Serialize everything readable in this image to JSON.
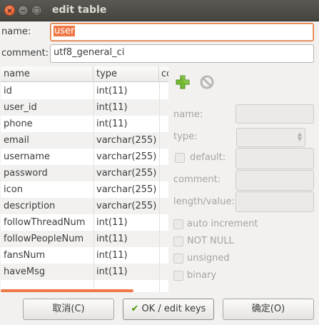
{
  "window": {
    "title": "edit table",
    "close_glyph": "×",
    "minimize_glyph": "−",
    "maximize_glyph": "□"
  },
  "form": {
    "name_label": "name:",
    "name_value": "user",
    "comment_label": "comment:",
    "comment_value": "utf8_general_ci"
  },
  "table": {
    "columns": [
      "name",
      "type",
      "co"
    ],
    "rows": [
      {
        "name": "id",
        "type": "int(11)"
      },
      {
        "name": "user_id",
        "type": "int(11)"
      },
      {
        "name": "phone",
        "type": "int(11)"
      },
      {
        "name": "email",
        "type": "varchar(255)"
      },
      {
        "name": "username",
        "type": "varchar(255)"
      },
      {
        "name": "password",
        "type": "varchar(255)"
      },
      {
        "name": "icon",
        "type": "varchar(255)"
      },
      {
        "name": "description",
        "type": "varchar(255)"
      },
      {
        "name": "followThreadNum",
        "type": "int(11)"
      },
      {
        "name": "followPeopleNum",
        "type": "int(11)"
      },
      {
        "name": "fansNum",
        "type": "int(11)"
      },
      {
        "name": "haveMsg",
        "type": "int(11)"
      }
    ]
  },
  "column_editor": {
    "add_icon": "plus-icon",
    "remove_icon": "cancel-icon",
    "name_label": "name:",
    "type_label": "type:",
    "default_label": "default:",
    "comment_label": "comment:",
    "length_label": "length/value:",
    "auto_increment_label": "auto increment",
    "not_null_label": "NOT NULL",
    "unsigned_label": "unsigned",
    "binary_label": "binary"
  },
  "buttons": {
    "cancel_label": "取消(C)",
    "edit_keys_label": "OK / edit keys",
    "ok_label": "确定(O)"
  },
  "colors": {
    "accent": "#f07746",
    "titlebar": "#4f4e49",
    "add_icon": "#6aab2b"
  }
}
